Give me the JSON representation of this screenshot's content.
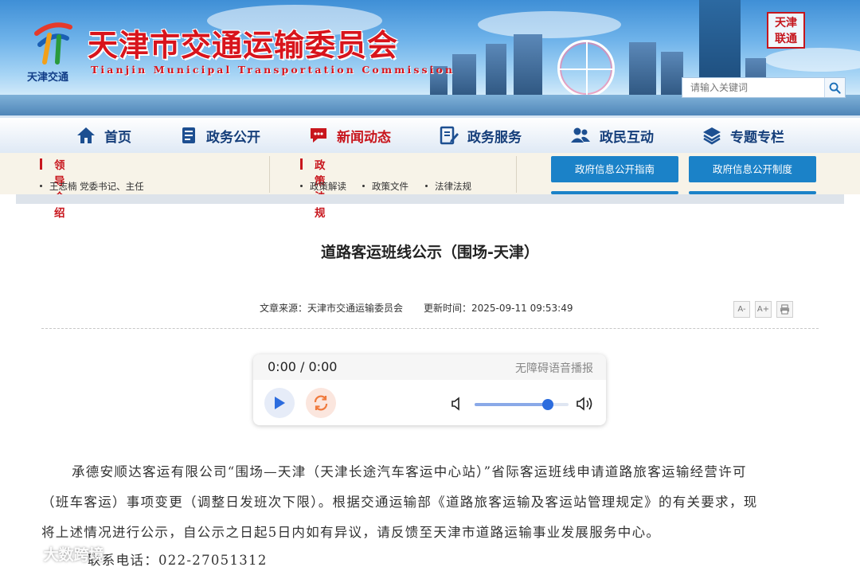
{
  "header": {
    "title": "天津市交通运输委员会",
    "subtitle": "Tianjin Municipal Transportation Commission",
    "logo_text": "天津交通",
    "seal_text": "天津 联通",
    "search_placeholder": "请输入关键词"
  },
  "nav": [
    {
      "label": "首页",
      "icon": "home-icon"
    },
    {
      "label": "政务公开",
      "icon": "book-icon"
    },
    {
      "label": "新闻动态",
      "icon": "chat-bubble-icon"
    },
    {
      "label": "政务服务",
      "icon": "document-edit-icon"
    },
    {
      "label": "政民互动",
      "icon": "people-icon"
    },
    {
      "label": "专题专栏",
      "icon": "layers-icon"
    }
  ],
  "subbar": {
    "leaders": {
      "heading": "领导介绍",
      "items": [
        "王志楠 党委书记、主任"
      ]
    },
    "policy": {
      "heading": "政策法规",
      "items": [
        "政策解读",
        "政策文件",
        "法律法规"
      ]
    },
    "buttons": [
      "政府信息公开指南",
      "政府信息公开制度"
    ]
  },
  "article": {
    "title": "道路客运班线公示（围场-天津）",
    "source": "文章来源：天津市交通运输委员会",
    "updated": "更新时间：2025-09-11 09:53:49",
    "tools": [
      "A-",
      "A+",
      "print"
    ],
    "player": {
      "time": "0:00 / 0:00",
      "label": "无障碍语音播报",
      "volume_fraction": 0.78
    },
    "paragraph_lines": [
      "承德安顺达客运有限公司“围场—天津（天津长途汽车客运中心站）”省际客运班线申请道路旅客运输经营许可",
      "（班车客运）事项变更（调整日发班次下限）。根据交通运输部《道路旅客运输及客运站管理规定》的有关要求，现",
      "将上述情况进行公示，自公示之日起5日内如有异议，请反馈至天津市道路运输事业发展服务中心。",
      "联系电话：022-27051312"
    ]
  },
  "watermark": "大数跨境",
  "colors": {
    "brand_red": "#d8141c",
    "nav_blue": "#153e7a",
    "button_blue": "#1b82c8",
    "player_blue": "#2c6cde"
  }
}
